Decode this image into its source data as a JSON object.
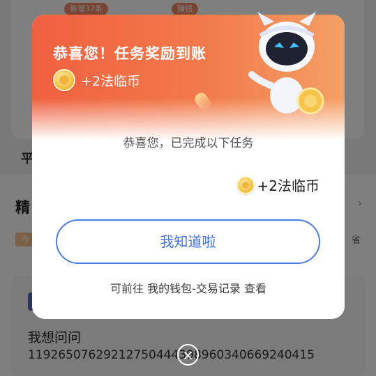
{
  "background": {
    "top_badges": [
      "新增37条",
      "赚钱"
    ],
    "band_text": "平",
    "section_title": "精",
    "section_more": "›",
    "tag": "今",
    "tag_right": "省",
    "post": {
      "title": "我想问问",
      "body": "11926507629212750444398960340669240415"
    }
  },
  "modal": {
    "title": "恭喜您！任务奖励到账",
    "reward": "+2法临币",
    "subtitle": "恭喜您，已完成以下任务",
    "earned": "+2法临币",
    "ok_button": "我知道啦",
    "footer_prefix": "可前往",
    "footer_link": "我的钱包-交易记录",
    "footer_suffix": "查看",
    "mascot_icon": "robot-mascot-icon",
    "coin_icon": "coin-icon"
  },
  "close_icon": "×",
  "colors": {
    "header_start": "#f06040",
    "header_end": "#f4a064",
    "button_blue": "#4a7ee6",
    "coin_gold": "#f5c54a"
  }
}
